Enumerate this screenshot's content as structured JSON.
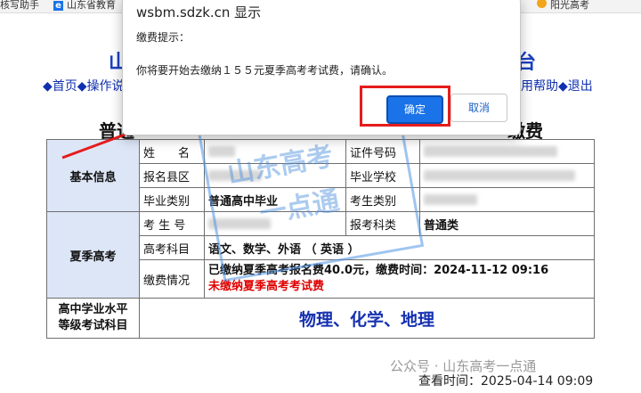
{
  "bookmarks": {
    "left": "核写助手",
    "mid": "山东省教育",
    "right": "阳光高考"
  },
  "page": {
    "title_left": "山",
    "title_right": "台",
    "nav_left": [
      "◆首页",
      "◆操作说"
    ],
    "nav_right": [
      "用帮助",
      "◆退出"
    ],
    "subtitle_left": "普通",
    "subtitle_right": "缴费"
  },
  "table": {
    "basic_section": "基本信息",
    "name_label": "姓　　名",
    "id_label": "证件号码",
    "county_label": "报名县区",
    "school_label": "毕业学校",
    "grad_type_label": "毕业类别",
    "grad_type_value": "普通高中毕业",
    "exam_type_label": "考生类别",
    "summer_section": "夏季高考",
    "exam_no_label": "考 生 号",
    "subject_type_label": "报考科类",
    "subject_type_value": "普通类",
    "subjects_label": "高考科目",
    "subjects_value": "语文、数学、外语 （ 英语 ）",
    "payment_label": "缴费情况",
    "payment_paid": "已缴纳夏季高考报名费40.0元，缴费时间：2024-11-12 09:16",
    "payment_unpaid": "未缴纳夏季高考考试费",
    "level_section_line1": "高中学业水平",
    "level_section_line2": "等级考试科目",
    "level_subjects": "物理、化学、地理"
  },
  "watermark": {
    "line1": "山东高考",
    "line2": "一点通",
    "account": "公众号 · 山东高考一点通"
  },
  "query_time": "查看时间：2025-04-14 09:09",
  "dialog": {
    "title": "wsbm.sdzk.cn 显示",
    "label": "缴费提示：",
    "message": "你将要开始去缴纳１５５元夏季高考考试费，请确认。",
    "ok_label": "确定",
    "cancel_label": "取消"
  }
}
